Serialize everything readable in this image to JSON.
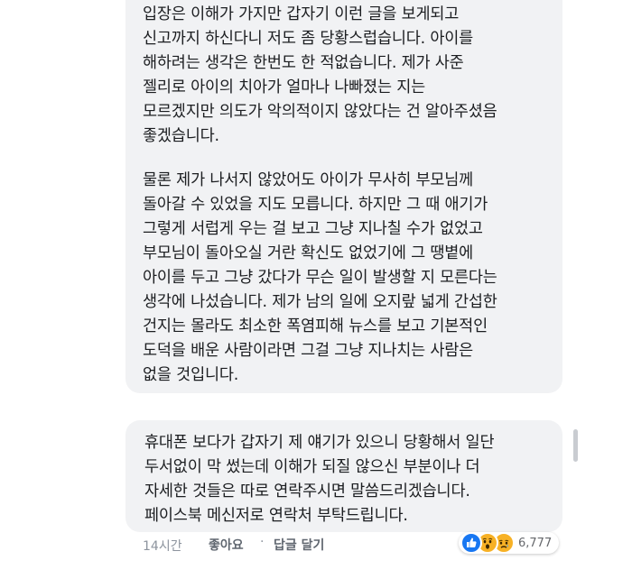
{
  "comment_top": {
    "paragraph_1": "입장은 이해가 가지만 갑자기 이런 글을 보게되고\n신고까지 하신다니 저도 좀 당황스럽습니다. 아이를\n해하려는 생각은 한번도 한 적없습니다. 제가 사준\n젤리로 아이의 치아가 얼마나 나빠졌는 지는\n모르겠지만 의도가 악의적이지 않았다는 건 알아주셨음\n좋겠습니다.",
    "paragraph_2": "물론 제가 나서지 않았어도 아이가 무사히 부모님께\n돌아갈 수 있었을 지도 모릅니다. 하지만 그 때 애기가\n그렇게 서럽게 우는 걸 보고 그냥 지나칠 수가 없었고\n부모님이 돌아오실 거란 확신도 없었기에 그 땡볕에\n아이를 두고 그냥 갔다가 무슨 일이 발생할 지 모른다는\n생각에 나섰습니다. 제가 남의 일에 오지랖 넓게 간섭한\n건지는 몰라도 최소한 폭염피해 뉴스를 보고 기본적인\n도덕을 배운 사람이라면 그걸 그냥 지나치는 사람은\n없을 것입니다."
  },
  "comment_bottom": {
    "text": "휴대폰 보다가 갑자기 제 얘기가 있으니 당황해서 일단\n두서없이 막 썼는데 이해가 되질 않으신 부분이나 더\n자세한 것들은 따로 연락주시면 말씀드리겠습니다.\n페이스북 메신저로 연락처 부탁드립니다."
  },
  "meta": {
    "time": "14시간",
    "like_label": "좋아요",
    "separator": "·",
    "reply_label": "답글 달기",
    "reaction_count": "6,777",
    "reaction_icons": [
      "like-icon",
      "wow-icon",
      "sad-icon"
    ]
  },
  "colors": {
    "bubble_bg": "#f1f2f4",
    "text": "#1c1e21",
    "meta_text": "#606770",
    "like_blue": "#1877f2",
    "emoji_yellow": "#f7b125"
  }
}
